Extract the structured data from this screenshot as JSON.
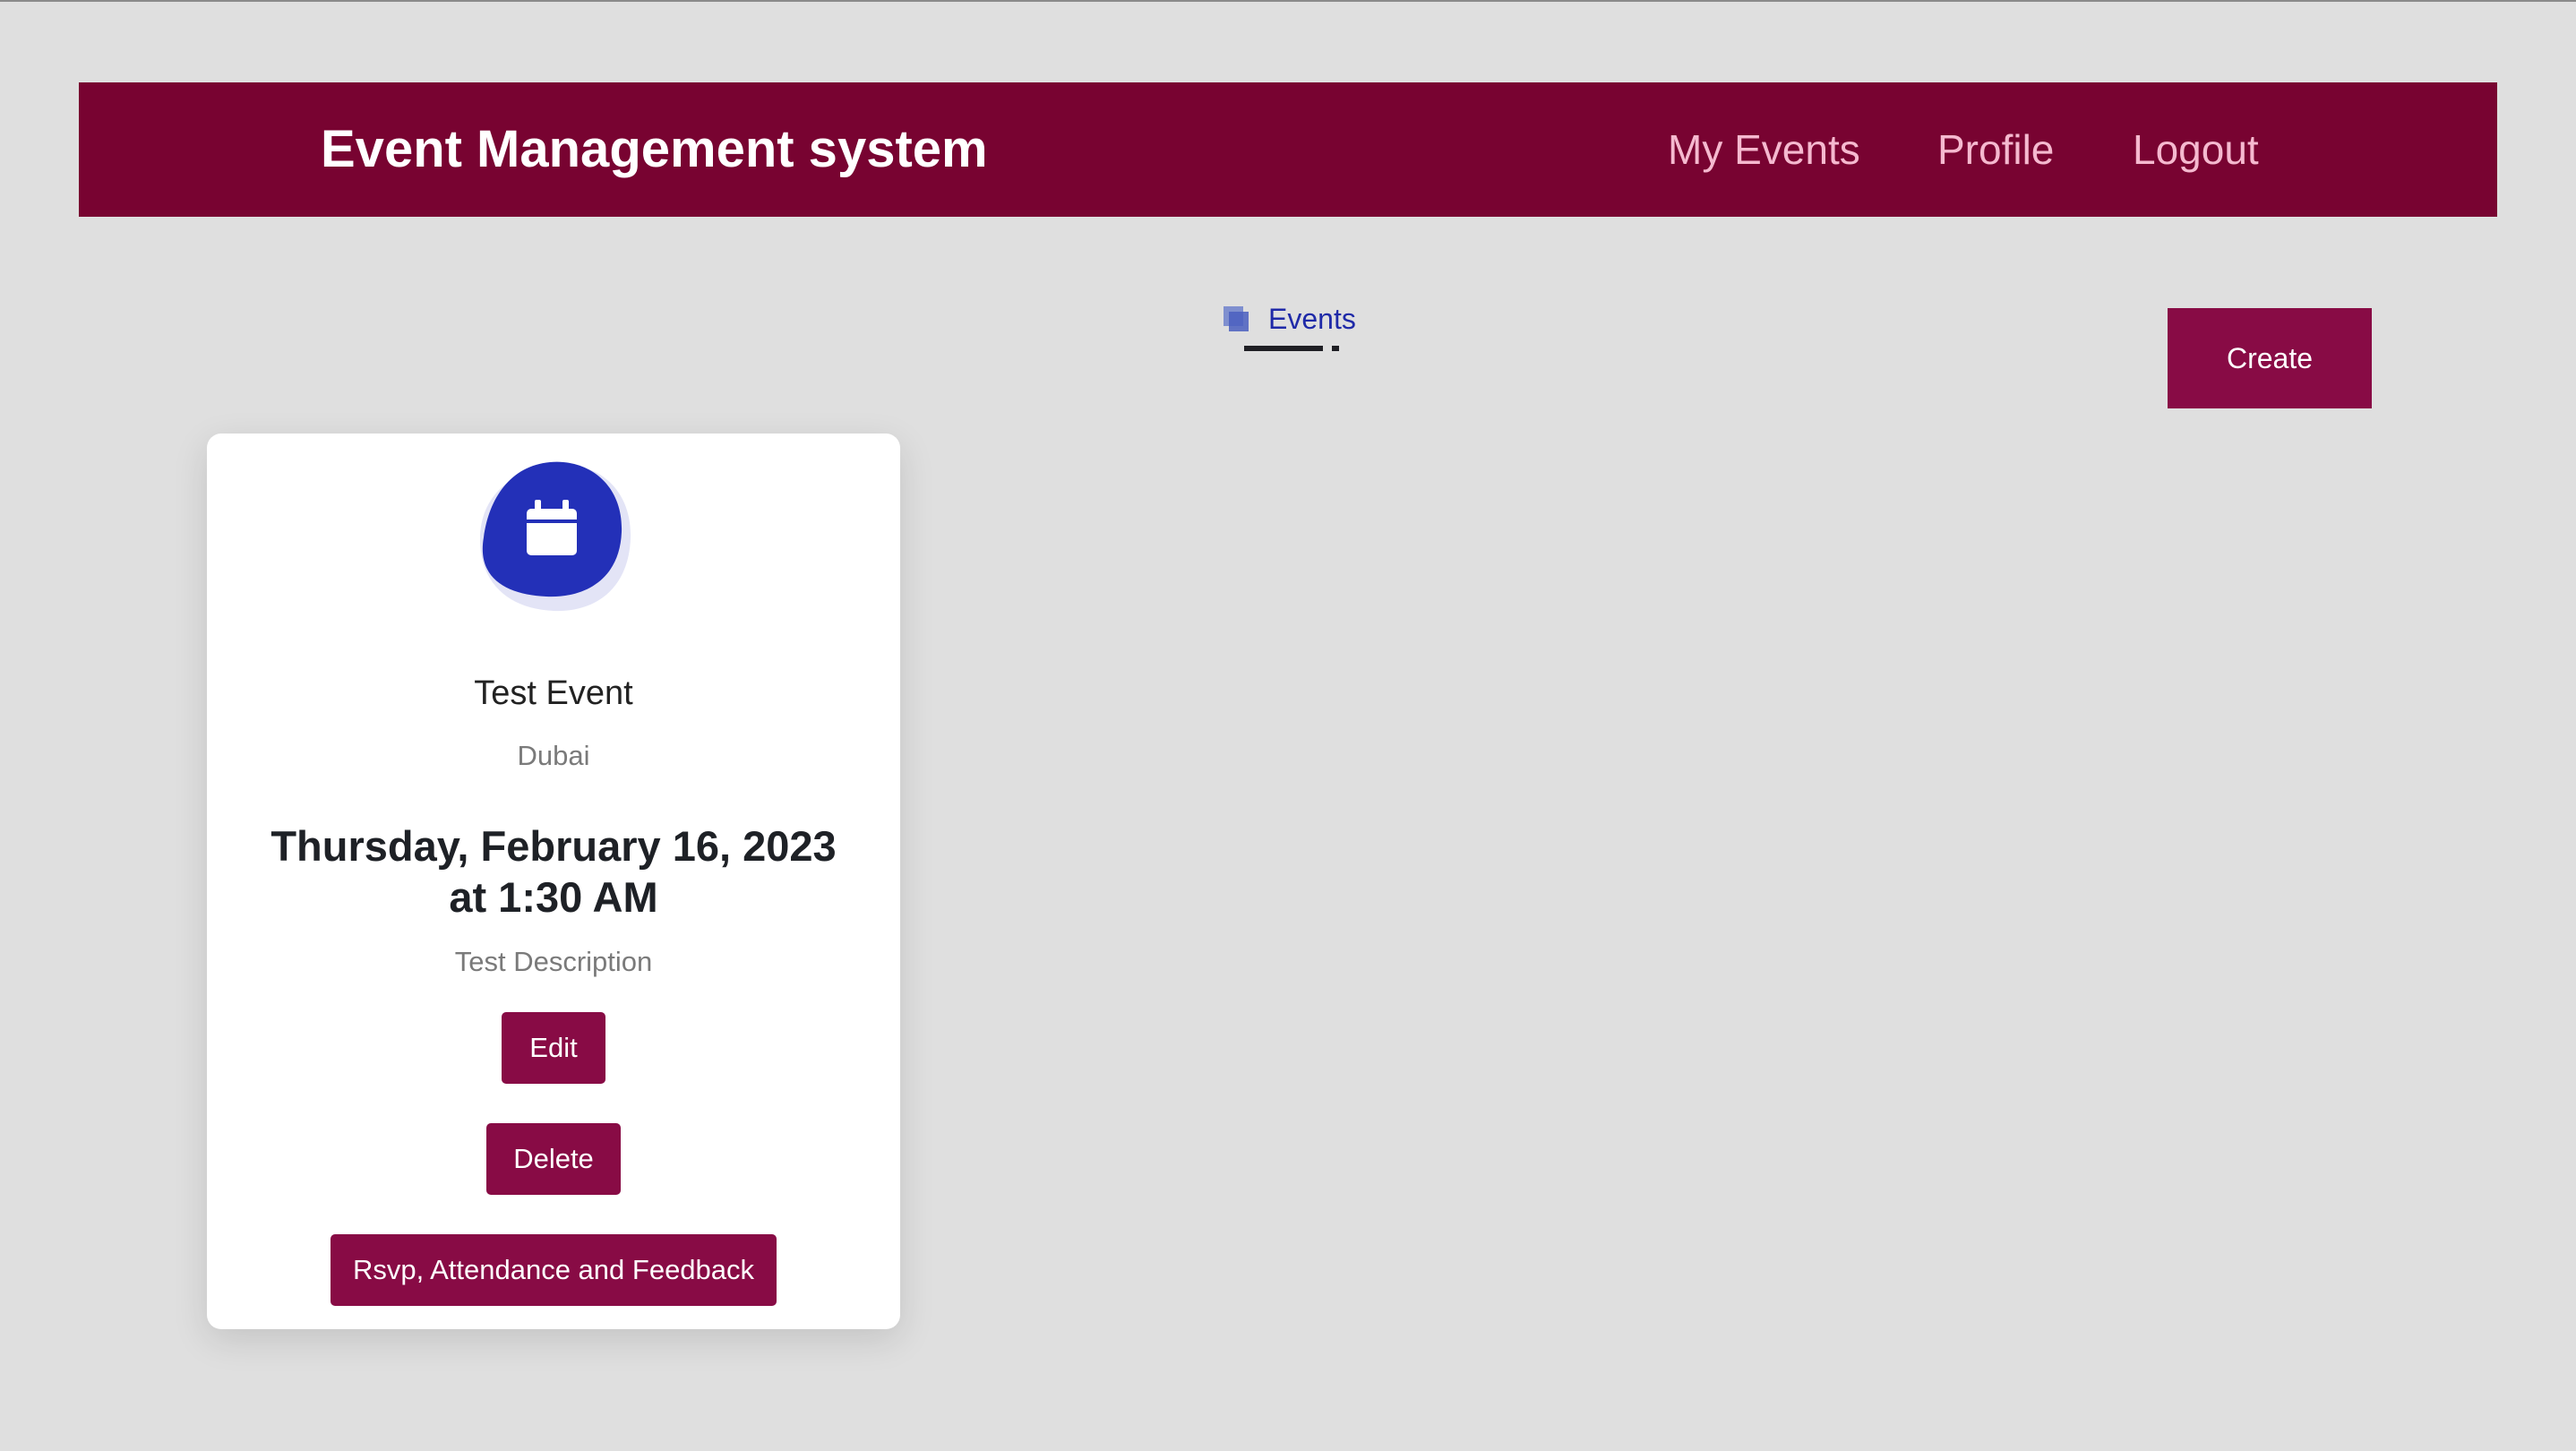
{
  "navbar": {
    "brand": "Event Management system",
    "links": [
      {
        "label": "My Events"
      },
      {
        "label": "Profile"
      },
      {
        "label": "Logout"
      }
    ]
  },
  "tabs": {
    "events_label": "Events",
    "events_icon": "layers-icon"
  },
  "actions": {
    "create_label": "Create"
  },
  "event_card": {
    "icon": "calendar-icon",
    "title": "Test Event",
    "location": "Dubai",
    "datetime": "Thursday, February 16, 2023 at 1:30 AM",
    "description": "Test Description",
    "buttons": {
      "edit": "Edit",
      "delete": "Delete",
      "rsvp": "Rsvp, Attendance and Feedback"
    }
  },
  "colors": {
    "navbar_bg": "#780331",
    "nav_link": "#f5b9cf",
    "button_bg": "#880b45",
    "tab_text": "#1f2aa8",
    "icon_blob": "#2330b8",
    "page_bg": "#dfdfdf"
  }
}
